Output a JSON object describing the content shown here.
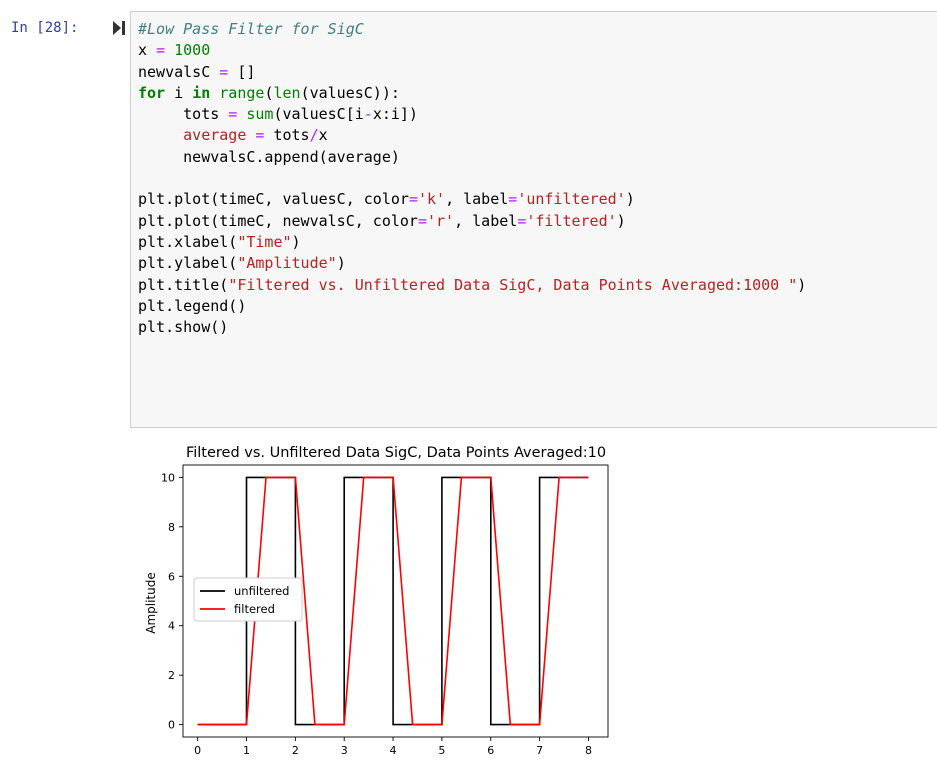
{
  "cell": {
    "prompt": "In [28]:",
    "code": {
      "comment": "#Low Pass Filter for SigC",
      "x_assign_var": "x",
      "x_assign_val": "1000",
      "newvals_var": "newvalsC",
      "newvals_val": "[]",
      "for_kw": "for",
      "for_var": "i",
      "in_kw": "in",
      "range_fn": "range",
      "len_fn": "len",
      "for_rest": "(valuesC)):",
      "tots_var": "tots",
      "sum_fn": "sum",
      "tots_args_a": "(valuesC[i",
      "tots_minus": "-",
      "tots_args_b": "x:i])",
      "avg_var": "average",
      "avg_a": "tots",
      "avg_div": "/",
      "avg_b": "x",
      "append_line": "newvalsC.append(average)",
      "plot1_a": "plt.plot(timeC, valuesC, color",
      "plot1_color": "'k'",
      "plot1_b": ", label",
      "plot1_label": "'unfiltered'",
      "plot1_c": ")",
      "plot2_a": "plt.plot(timeC, newvalsC, color",
      "plot2_color": "'r'",
      "plot2_b": ", label",
      "plot2_label": "'filtered'",
      "plot2_c": ")",
      "xlabel_a": "plt.xlabel(",
      "xlabel_s": "\"Time\"",
      "xlabel_c": ")",
      "ylabel_a": "plt.ylabel(",
      "ylabel_s": "\"Amplitude\"",
      "ylabel_c": ")",
      "title_a": "plt.title(",
      "title_s": "\"Filtered vs. Unfiltered Data SigC, Data Points Averaged:1000 \"",
      "title_c": ")",
      "legend_line": "plt.legend()",
      "show_line": "plt.show()"
    }
  },
  "chart_data": {
    "type": "line",
    "title": "Filtered vs. Unfiltered Data SigC, Data Points Averaged:10",
    "xlabel": "",
    "ylabel": "Amplitude",
    "xlim": [
      -0.3,
      8.4
    ],
    "ylim": [
      -0.5,
      10.5
    ],
    "xticks": [
      "0",
      "1",
      "2",
      "3",
      "4",
      "5",
      "6",
      "7",
      "8"
    ],
    "yticks": [
      "0",
      "2",
      "4",
      "6",
      "8",
      "10"
    ],
    "legend_position": "center-left",
    "series": [
      {
        "name": "unfiltered",
        "color": "#000000",
        "x": [
          0,
          1,
          1,
          2,
          2,
          3,
          3,
          4,
          4,
          5,
          5,
          6,
          6,
          7,
          7,
          8
        ],
        "y": [
          0,
          0,
          10,
          10,
          0,
          0,
          10,
          10,
          0,
          0,
          10,
          10,
          0,
          0,
          10,
          10
        ]
      },
      {
        "name": "filtered",
        "color": "#ff0000",
        "x": [
          0,
          1,
          1.4,
          2,
          2.4,
          3,
          3.4,
          4,
          4.4,
          5,
          5.4,
          6,
          6.4,
          7,
          7.4,
          8
        ],
        "y": [
          0,
          0,
          10,
          10,
          0,
          0,
          10,
          10,
          0,
          0,
          10,
          10,
          0,
          0,
          10,
          10
        ]
      }
    ]
  }
}
